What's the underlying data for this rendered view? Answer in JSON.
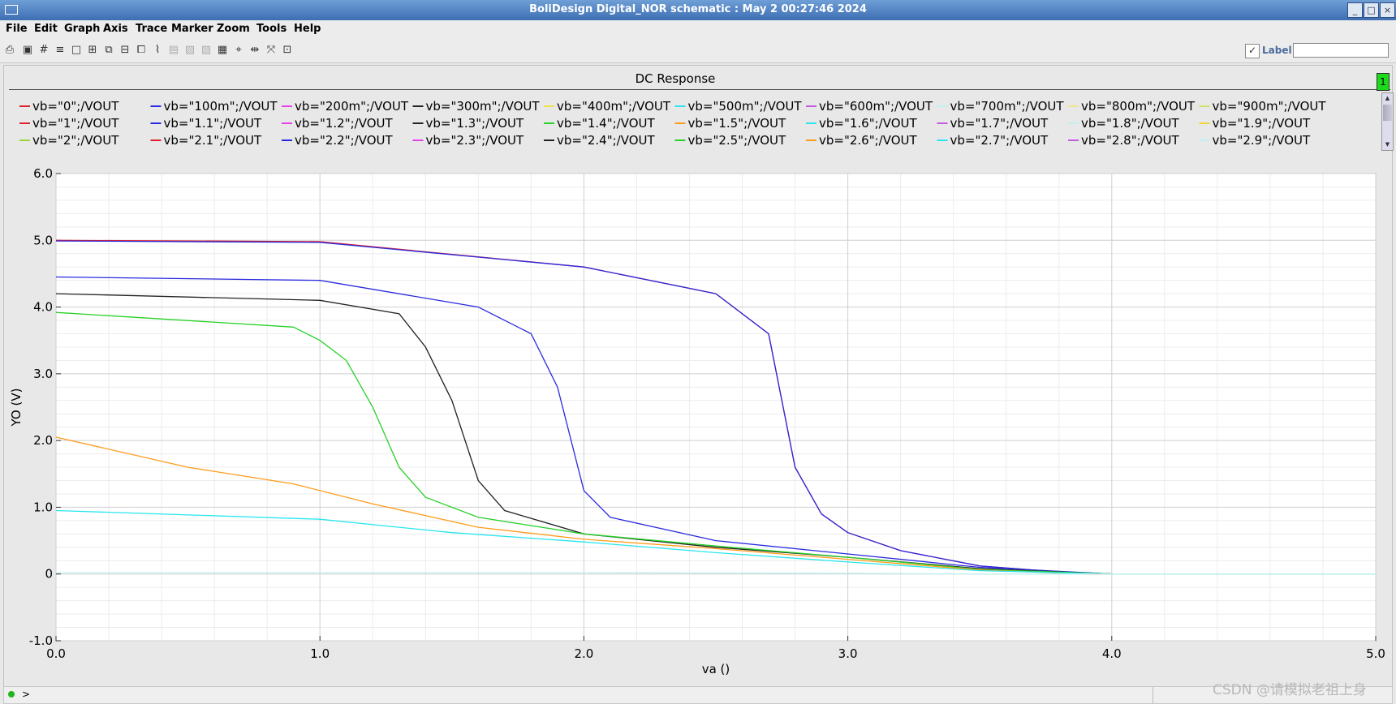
{
  "window": {
    "title": "BoliDesign Digital_NOR schematic : May  2 00:27:46 2024",
    "buttons": [
      "_",
      "□",
      "×"
    ]
  },
  "menu": [
    "File",
    "Edit",
    "Graph",
    "Axis",
    "Trace",
    "Marker",
    "Zoom",
    "Tools",
    "Help"
  ],
  "toolbar": {
    "tools": [
      "print-icon",
      "image-icon",
      "grid-icon",
      "strips-icon",
      "single-graph-icon",
      "zoom-in-icon",
      "zoom-fit-icon",
      "strip-split-icon",
      "zoom-area-icon",
      "marker-icon",
      "disabled-tool-icon",
      "disabled-tool-icon",
      "disabled-tool-icon",
      "calculator-icon",
      "cross-hair-icon",
      "horizontal-marker-icon",
      "fit-window-icon",
      "fit-all-icon"
    ],
    "label_checkbox_checked": true,
    "label_text": "Label",
    "label_input_value": ""
  },
  "panel": {
    "title": "DC Response",
    "indicator": "1"
  },
  "legend": [
    {
      "label": "vb=\"0\";/VOUT",
      "color": "#e0202a"
    },
    {
      "label": "vb=\"100m\";/VOUT",
      "color": "#2a2adf"
    },
    {
      "label": "vb=\"200m\";/VOUT",
      "color": "#ec3fec"
    },
    {
      "label": "vb=\"300m\";/VOUT",
      "color": "#222222"
    },
    {
      "label": "vb=\"400m\";/VOUT",
      "color": "#f2e04a"
    },
    {
      "label": "vb=\"500m\";/VOUT",
      "color": "#29e6ee"
    },
    {
      "label": "vb=\"600m\";/VOUT",
      "color": "#c45ae0"
    },
    {
      "label": "vb=\"700m\";/VOUT",
      "color": "#bff0ef"
    },
    {
      "label": "vb=\"800m\";/VOUT",
      "color": "#eee78a"
    },
    {
      "label": "vb=\"900m\";/VOUT",
      "color": "#cfe26a"
    },
    {
      "label": "vb=\"1\";/VOUT",
      "color": "#e0202a"
    },
    {
      "label": "vb=\"1.1\";/VOUT",
      "color": "#2a2adf"
    },
    {
      "label": "vb=\"1.2\";/VOUT",
      "color": "#ec3fec"
    },
    {
      "label": "vb=\"1.3\";/VOUT",
      "color": "#222222"
    },
    {
      "label": "vb=\"1.4\";/VOUT",
      "color": "#27d127"
    },
    {
      "label": "vb=\"1.5\";/VOUT",
      "color": "#ff9b1a"
    },
    {
      "label": "vb=\"1.6\";/VOUT",
      "color": "#29e6ee"
    },
    {
      "label": "vb=\"1.7\";/VOUT",
      "color": "#c45ae0"
    },
    {
      "label": "vb=\"1.8\";/VOUT",
      "color": "#bff0ef"
    },
    {
      "label": "vb=\"1.9\";/VOUT",
      "color": "#f0d43a"
    },
    {
      "label": "vb=\"2\";/VOUT",
      "color": "#9fd33a"
    },
    {
      "label": "vb=\"2.1\";/VOUT",
      "color": "#e0202a"
    },
    {
      "label": "vb=\"2.2\";/VOUT",
      "color": "#2a2adf"
    },
    {
      "label": "vb=\"2.3\";/VOUT",
      "color": "#ec3fec"
    },
    {
      "label": "vb=\"2.4\";/VOUT",
      "color": "#222222"
    },
    {
      "label": "vb=\"2.5\";/VOUT",
      "color": "#27d127"
    },
    {
      "label": "vb=\"2.6\";/VOUT",
      "color": "#ff9b1a"
    },
    {
      "label": "vb=\"2.7\";/VOUT",
      "color": "#29e6ee"
    },
    {
      "label": "vb=\"2.8\";/VOUT",
      "color": "#c45ae0"
    },
    {
      "label": "vb=\"2.9\";/VOUT",
      "color": "#bff0ef"
    }
  ],
  "chart_data": {
    "type": "line",
    "title": "DC Response",
    "xlabel": "va ()",
    "ylabel": "YO (V)",
    "xlim": [
      0,
      5
    ],
    "ylim": [
      -1,
      6
    ],
    "xticks": [
      "0.0",
      "1.0",
      "2.0",
      "3.0",
      "4.0",
      "5.0"
    ],
    "yticks": [
      "-1.0",
      "0",
      "1.0",
      "2.0",
      "3.0",
      "4.0",
      "5.0",
      "6.0"
    ],
    "grid": true,
    "series": [
      {
        "name": "vb=\"0\";/VOUT",
        "color": "#e0202a",
        "x": [
          0,
          1,
          2,
          2.5,
          2.7,
          2.8,
          2.9,
          3.0,
          3.2,
          3.5,
          3.8,
          4.0,
          5.0
        ],
        "y": [
          5.0,
          4.98,
          4.6,
          4.2,
          3.6,
          1.6,
          0.9,
          0.62,
          0.35,
          0.12,
          0.03,
          0.0,
          0.0
        ]
      },
      {
        "name": "vb=\"100m\";/VOUT",
        "color": "#2a2adf",
        "x": [
          0,
          1,
          2,
          2.5,
          2.7,
          2.8,
          2.9,
          3.0,
          3.2,
          3.5,
          3.8,
          4.0,
          5.0
        ],
        "y": [
          4.99,
          4.97,
          4.6,
          4.2,
          3.6,
          1.6,
          0.9,
          0.62,
          0.35,
          0.12,
          0.03,
          0.0,
          0.0
        ]
      },
      {
        "name": "vb=\"1.1\";/VOUT",
        "color": "#2a2adf",
        "x": [
          0,
          1,
          1.6,
          1.8,
          1.9,
          2.0,
          2.1,
          2.5,
          3.0,
          3.5,
          4.0,
          5.0
        ],
        "y": [
          4.45,
          4.4,
          4.0,
          3.6,
          2.8,
          1.25,
          0.85,
          0.5,
          0.3,
          0.1,
          0.0,
          0.0
        ]
      },
      {
        "name": "vb=\"1.3\";/VOUT",
        "color": "#222222",
        "x": [
          0,
          1,
          1.3,
          1.4,
          1.5,
          1.6,
          1.7,
          2.0,
          2.5,
          3.0,
          3.5,
          4.0,
          5.0
        ],
        "y": [
          4.2,
          4.1,
          3.9,
          3.4,
          2.6,
          1.4,
          0.95,
          0.6,
          0.4,
          0.25,
          0.08,
          0.0,
          0.0
        ]
      },
      {
        "name": "vb=\"1.4\";/VOUT",
        "color": "#27d127",
        "x": [
          0,
          0.9,
          1.0,
          1.1,
          1.2,
          1.3,
          1.4,
          1.6,
          2.0,
          2.5,
          3.0,
          3.5,
          4.0,
          5.0
        ],
        "y": [
          3.92,
          3.7,
          3.5,
          3.2,
          2.5,
          1.6,
          1.15,
          0.85,
          0.6,
          0.42,
          0.25,
          0.07,
          0.0,
          0.0
        ]
      },
      {
        "name": "vb=\"1.5\";/VOUT",
        "color": "#ff9b1a",
        "x": [
          0,
          0.5,
          0.9,
          1.2,
          1.6,
          2.0,
          2.5,
          3.0,
          3.5,
          3.9,
          5.0
        ],
        "y": [
          2.05,
          1.6,
          1.35,
          1.05,
          0.7,
          0.52,
          0.38,
          0.22,
          0.06,
          0.0,
          0.0
        ]
      },
      {
        "name": "vb=\"1.6\";/VOUT",
        "color": "#29e6ee",
        "x": [
          0,
          1.0,
          1.5,
          2.0,
          2.5,
          3.0,
          3.5,
          4.0,
          5.0
        ],
        "y": [
          0.95,
          0.82,
          0.62,
          0.48,
          0.32,
          0.18,
          0.05,
          0.0,
          0.0
        ]
      },
      {
        "name": "vb=\"2.9\";/VOUT",
        "color": "#bff0ef",
        "x": [
          0,
          1.0,
          2.0,
          3.0,
          3.5,
          4.0,
          5.0
        ],
        "y": [
          0.02,
          0.02,
          0.02,
          0.01,
          0.0,
          0.0,
          0.0
        ]
      }
    ]
  },
  "status": {
    "prompt": ">"
  },
  "watermark": "CSDN @请模拟老祖上身"
}
